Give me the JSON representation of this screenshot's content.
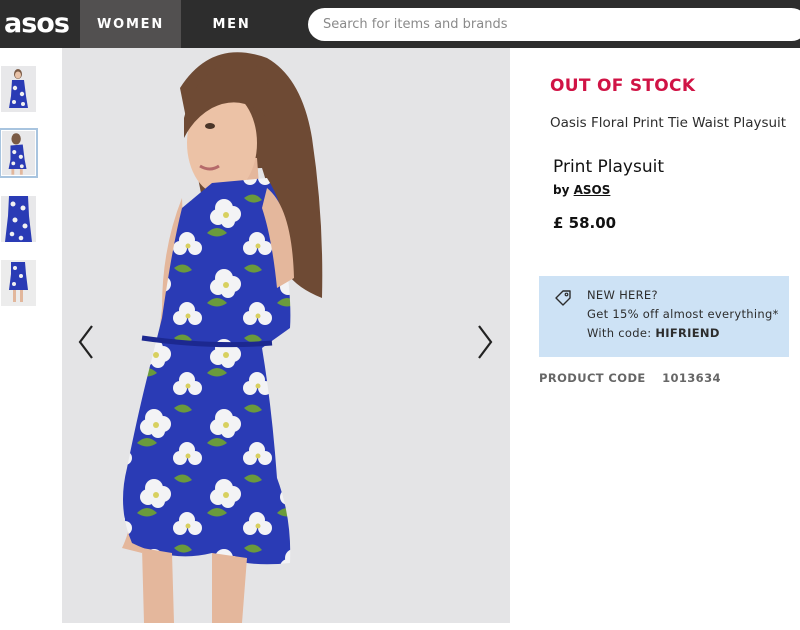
{
  "header": {
    "logo": "asos",
    "nav": [
      {
        "label": "WOMEN",
        "active": true
      },
      {
        "label": "MEN",
        "active": false
      }
    ],
    "search": {
      "placeholder": "Search for items and brands",
      "value": ""
    }
  },
  "gallery": {
    "thumbnail_count": 4,
    "active_thumbnail": 2,
    "prev_icon": "chevron-left-icon",
    "next_icon": "chevron-right-icon"
  },
  "product": {
    "stock_status": "OUT OF STOCK",
    "name": "Oasis Floral Print Tie Waist Playsuit",
    "variant_title": "Print Playsuit",
    "by_prefix": "by",
    "brand": "ASOS",
    "price": "£ 58.00"
  },
  "promo": {
    "icon": "tag-icon",
    "heading": "NEW HERE?",
    "text": "Get 15% off almost everything*",
    "code_prefix": "With code:",
    "code": "HIFRIEND"
  },
  "product_code": {
    "label": "PRODUCT CODE",
    "value": "1013634"
  },
  "colors": {
    "topbar": "#2d2d2d",
    "active_tab": "#525050",
    "stock_red": "#d01345",
    "promo_bg": "#cde2f5",
    "dress_blue": "#2a3bb5"
  }
}
